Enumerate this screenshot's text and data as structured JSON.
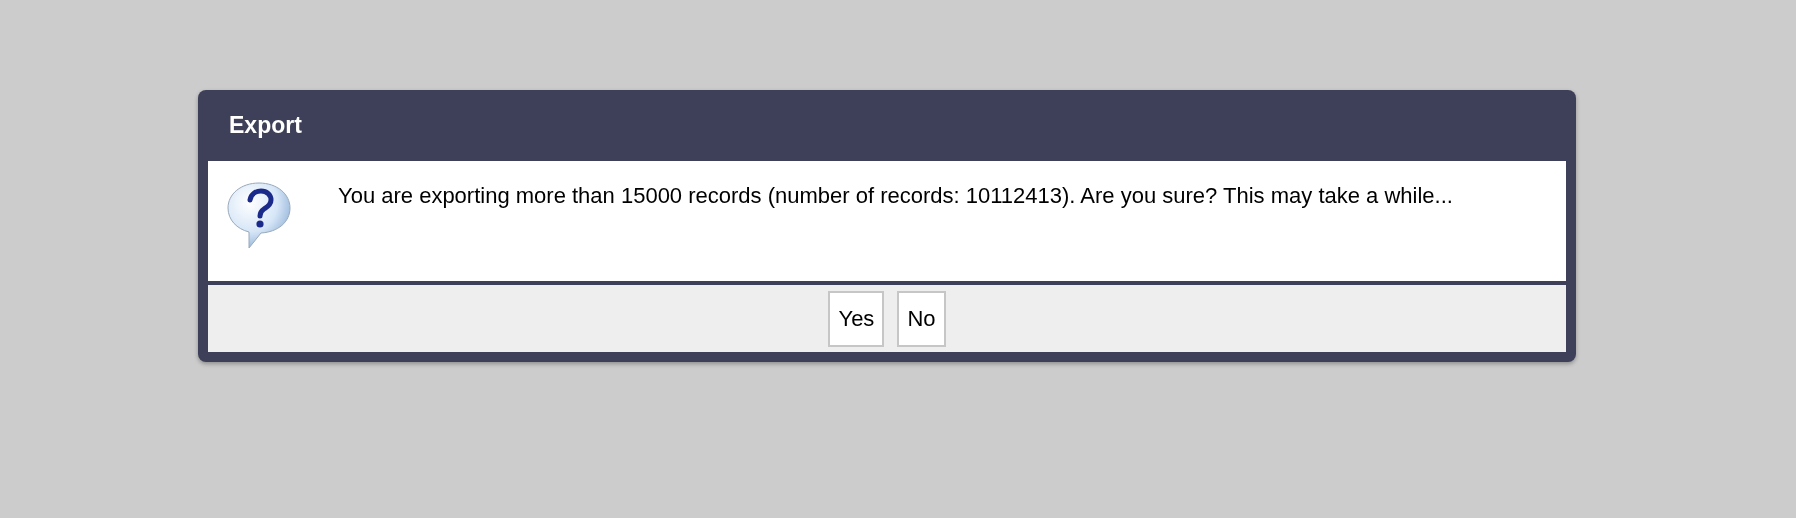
{
  "dialog": {
    "title": "Export",
    "message": "You are exporting more than 15000 records (number of records: 10112413). Are you sure? This may take a while...",
    "buttons": [
      "Yes",
      "No"
    ]
  }
}
